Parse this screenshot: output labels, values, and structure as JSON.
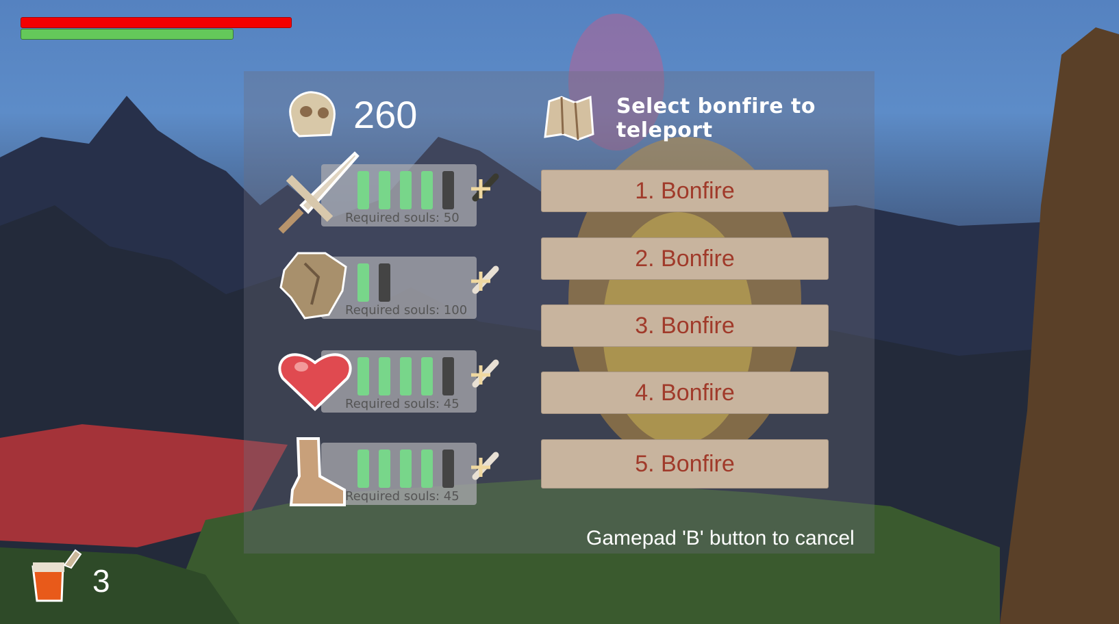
{
  "hud": {
    "health_fraction": 1.0,
    "stamina_fraction": 0.79,
    "potion_count": "3",
    "colors": {
      "health": "#f40000",
      "stamina": "#64c85a"
    }
  },
  "souls": {
    "count": "260",
    "icon": "skull-icon"
  },
  "upgrades": [
    {
      "name": "sword",
      "icon": "sword-icon",
      "level": 4,
      "max": 5,
      "required": "Required souls: 50"
    },
    {
      "name": "armor",
      "icon": "armor-icon",
      "level": 1,
      "max": 2,
      "required": "Required souls: 100"
    },
    {
      "name": "health",
      "icon": "heart-icon",
      "level": 4,
      "max": 5,
      "required": "Required souls: 45"
    },
    {
      "name": "boots",
      "icon": "boot-icon",
      "level": 4,
      "max": 5,
      "required": "Required souls: 45"
    }
  ],
  "teleport": {
    "title_line1": "Select bonfire to",
    "title_line2": "teleport",
    "icon": "map-icon",
    "bonfires": [
      "1. Bonfire",
      "2. Bonfire",
      "3. Bonfire",
      "4. Bonfire",
      "5. Bonfire"
    ]
  },
  "cancel_hint": "Gamepad 'B' button to cancel"
}
